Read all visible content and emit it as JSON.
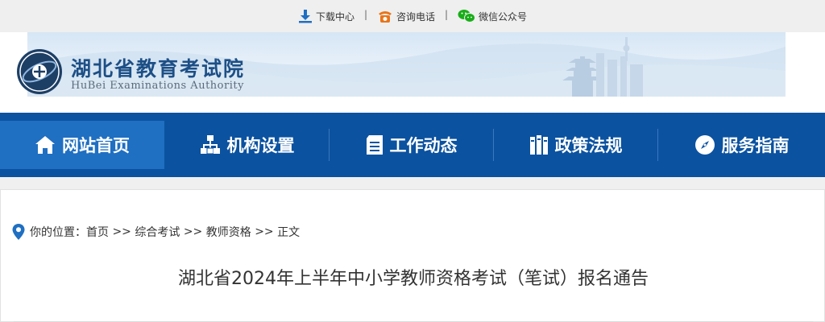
{
  "topbar": {
    "download_label": "下载中心",
    "phone_label": "咨询电话",
    "wechat_label": "微信公众号",
    "separator": "|"
  },
  "header": {
    "title_cn": "湖北省教育考试院",
    "title_en": "HuBei Examinations Authority"
  },
  "nav": {
    "items": [
      {
        "label": "网站首页",
        "icon": "home-icon"
      },
      {
        "label": "机构设置",
        "icon": "org-chart-icon"
      },
      {
        "label": "工作动态",
        "icon": "document-icon"
      },
      {
        "label": "政策法规",
        "icon": "books-icon"
      },
      {
        "label": "服务指南",
        "icon": "compass-icon"
      }
    ]
  },
  "breadcrumb": {
    "prefix": "你的位置：",
    "items": [
      "首页",
      "综合考试",
      "教师资格",
      "正文"
    ],
    "separator": ">>"
  },
  "article": {
    "title": "湖北省2024年上半年中小学教师资格考试（笔试）报名通告"
  },
  "colors": {
    "nav_bg": "#0b52a0",
    "nav_active": "#1f6fc2",
    "logo_text": "#1d4f86",
    "phone_icon": "#e8751a",
    "wechat_icon": "#1aad19",
    "download_icon": "#1f6fc2",
    "location_icon": "#1f6fc2"
  }
}
